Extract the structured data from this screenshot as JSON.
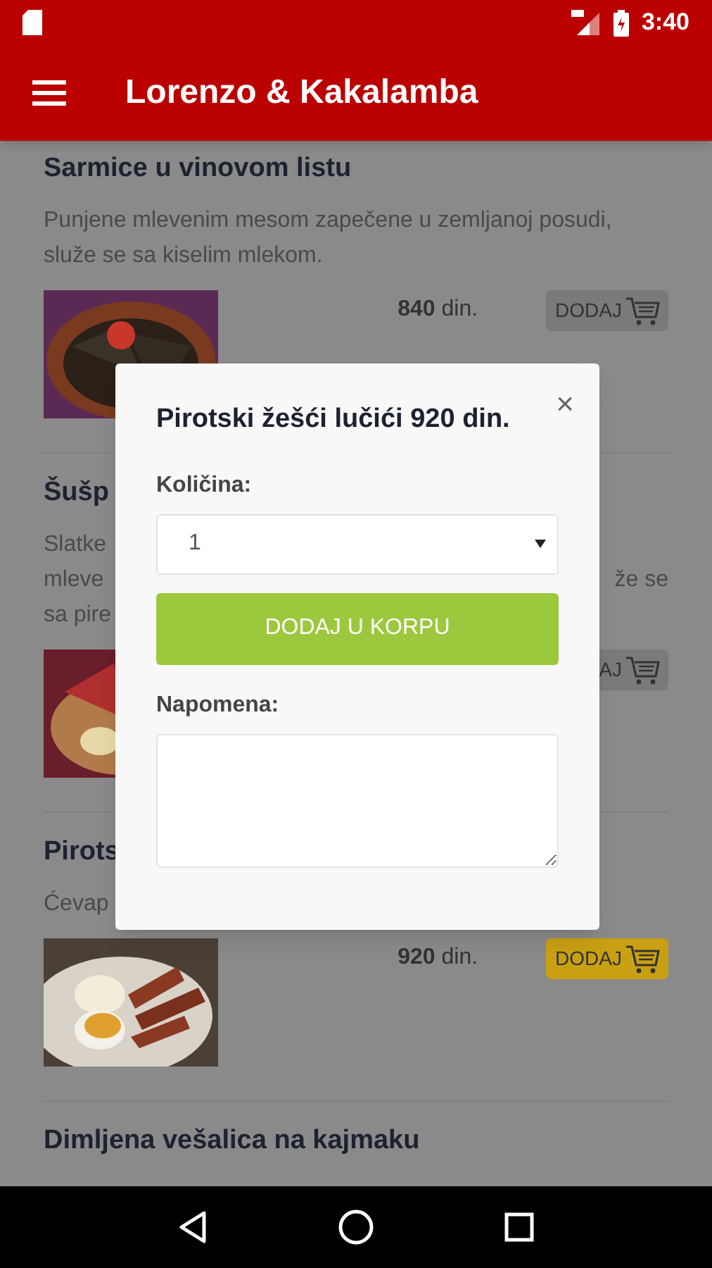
{
  "status_bar": {
    "time": "3:40"
  },
  "app_bar": {
    "title": "Lorenzo & Kakalamba"
  },
  "menu_items": [
    {
      "title": "Sarmice u vinovom listu",
      "description_lines": [
        {
          "left": "Punjene mlevenim mesom zapečene u zemljanoj posudi,"
        },
        {
          "left": "služe se sa kiselim mlekom."
        }
      ],
      "image": {
        "kind": "picture"
      },
      "price": "**840** din.",
      "button": {
        "label": "DODAJ",
        "highlighted": false
      }
    },
    {
      "title": "Šušp",
      "description_lines": [
        {
          "left": "Slatke"
        },
        {
          "left": "mleve",
          "right": "že se"
        },
        {
          "left": "sa pire"
        }
      ],
      "image": {
        "kind": "picture"
      },
      "button": {
        "label": "AJ",
        "highlighted": false
      }
    },
    {
      "title": "Pirots",
      "description_lines": [
        {
          "left": "Ćevap"
        }
      ],
      "image": {
        "kind": "picture"
      },
      "price": "**920** din.",
      "button": {
        "label": "DODAJ",
        "highlighted": true
      }
    },
    {
      "title": "Dimljena vešalica na kajmaku"
    }
  ],
  "dialog": {
    "title": "Pirotski žešći lučići 920 din.",
    "close": "×",
    "quantity_label": "Količina:",
    "quantity_value": "1",
    "add_button": "DODAJ U KORPU",
    "note_label": "Napomena:"
  }
}
